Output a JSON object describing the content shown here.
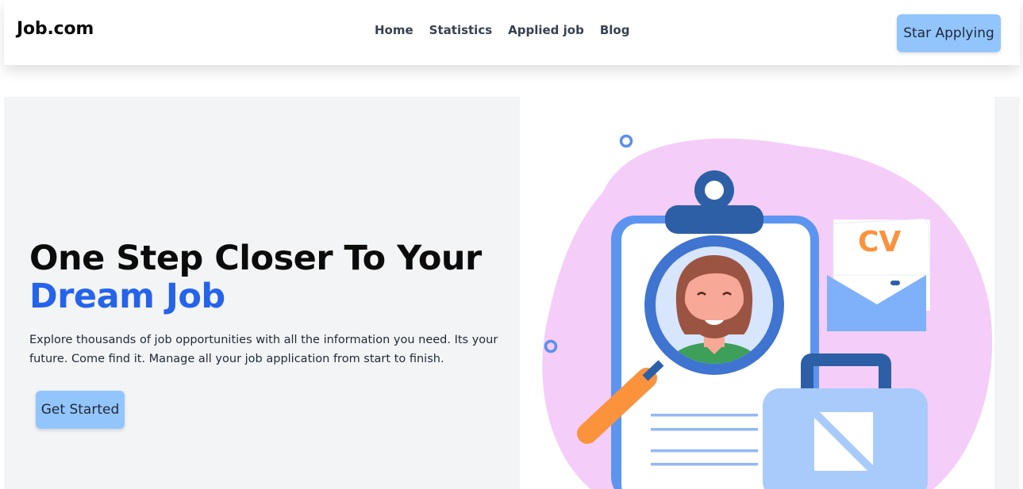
{
  "brand": {
    "name": "Job.com"
  },
  "nav": {
    "links": [
      {
        "label": "Home"
      },
      {
        "label": "Statistics"
      },
      {
        "label": "Applied job"
      },
      {
        "label": "Blog"
      }
    ],
    "cta_label": "Star Applying"
  },
  "hero": {
    "title_line1": "One Step Closer To Your",
    "title_accent": "Dream Job",
    "description": "Explore thousands of job opportunities with all the information you need. Its your future. Come find it. Manage all your job application from start to finish.",
    "button_label": "Get Started",
    "illustration": {
      "cv_label": "CV",
      "colors": {
        "blob": "#f5cdf9",
        "accent_blue": "#2d5fa6",
        "light_blue": "#7fb1fb",
        "orange": "#fb923c",
        "cv_orange": "#fb923c"
      }
    }
  },
  "colors": {
    "accent": "#2563eb",
    "button": "#93c5fd",
    "hero_bg": "#f3f4f6"
  }
}
